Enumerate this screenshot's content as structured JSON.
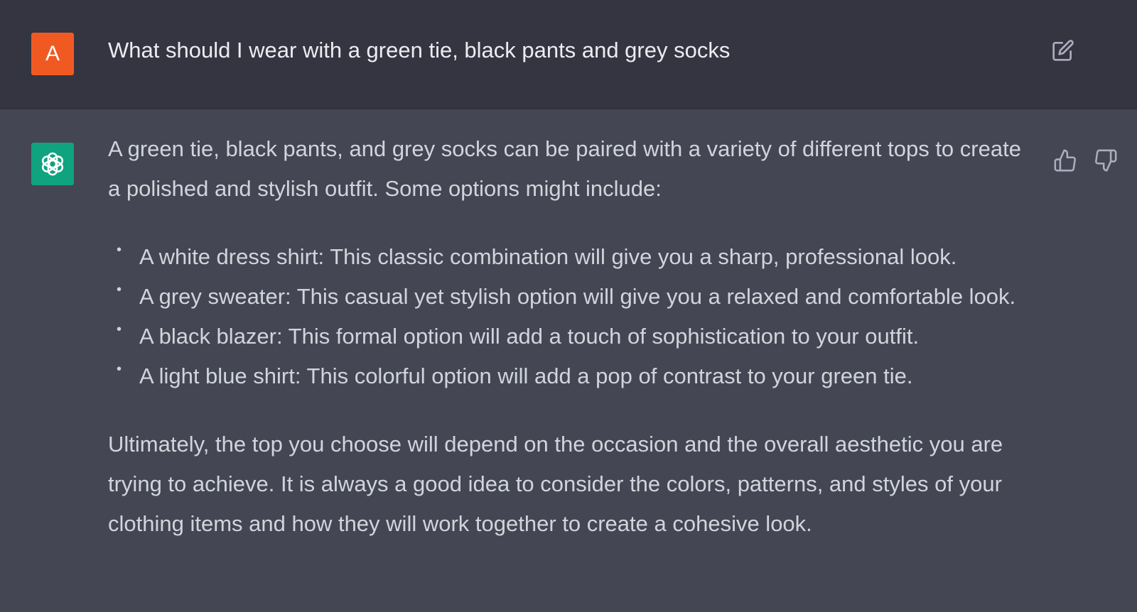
{
  "user_message": {
    "avatar_initial": "A",
    "avatar_color": "#f05a22",
    "text": "What should I wear with a green tie, black pants and grey socks",
    "edit_icon": "edit-icon"
  },
  "assistant_message": {
    "avatar_icon": "openai-logo-icon",
    "avatar_color": "#10a37f",
    "intro": "A green tie, black pants, and grey socks can be paired with a variety of different tops to create a polished and stylish outfit. Some options might include:",
    "items": [
      "A white dress shirt: This classic combination will give you a sharp, professional look.",
      "A grey sweater: This casual yet stylish option will give you a relaxed and comfortable look.",
      "A black blazer: This formal option will add a touch of sophistication to your outfit.",
      "A light blue shirt: This colorful option will add a pop of contrast to your green tie."
    ],
    "conclusion": "Ultimately, the top you choose will depend on the occasion and the overall aesthetic you are trying to achieve. It is always a good idea to consider the colors, patterns, and styles of your clothing items and how they will work together to create a cohesive look.",
    "feedback_icons": [
      "thumbs-up-icon",
      "thumbs-down-icon"
    ]
  },
  "colors": {
    "user_row_bg": "#343541",
    "assistant_row_bg": "#444654",
    "text_primary": "#ececf1",
    "text_secondary": "#d1d5db"
  }
}
